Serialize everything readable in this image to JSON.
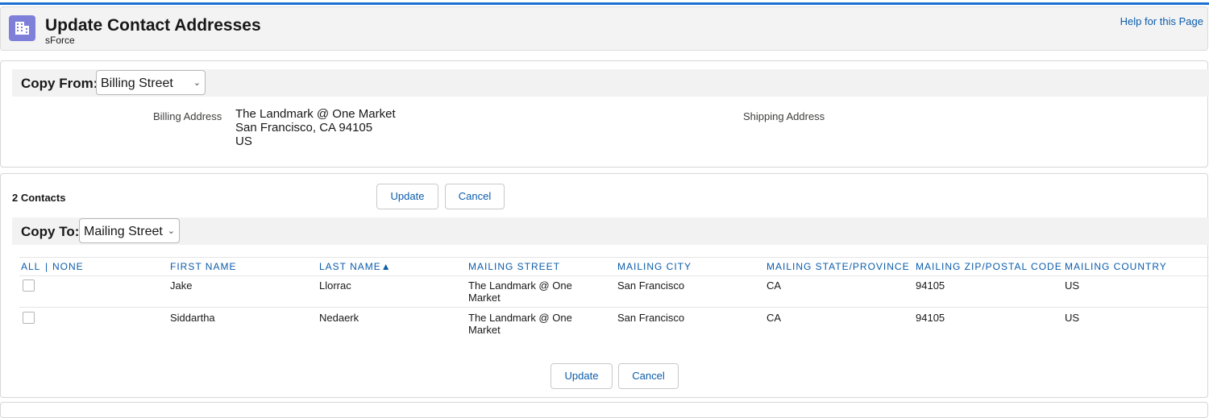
{
  "header": {
    "title": "Update Contact Addresses",
    "subtitle": "sForce",
    "help": "Help for this Page",
    "icon": "building-icon",
    "icon_color": "#7d7fd9"
  },
  "copy_from": {
    "label": "Copy From:",
    "selected": "Billing Street",
    "billing_label": "Billing Address",
    "billing_lines": [
      "The Landmark @ One Market",
      "San Francisco, CA 94105",
      "US"
    ],
    "shipping_label": "Shipping Address"
  },
  "contacts": {
    "count_label": "2 Contacts",
    "update": "Update",
    "cancel": "Cancel",
    "copy_to_label": "Copy To:",
    "copy_to_selected": "Mailing Street",
    "all": "ALL",
    "sep": "|",
    "none": "NONE",
    "columns": [
      "FIRST NAME",
      "LAST NAME▲",
      "MAILING STREET",
      "MAILING CITY",
      "MAILING STATE/PROVINCE",
      "MAILING ZIP/POSTAL CODE",
      "MAILING COUNTRY"
    ],
    "rows": [
      {
        "first": "Jake",
        "last": "Llorrac",
        "street": "The Landmark @ One Market",
        "city": "San Francisco",
        "state": "CA",
        "zip": "94105",
        "country": "US"
      },
      {
        "first": "Siddartha",
        "last": "Nedaerk",
        "street": "The Landmark @ One Market",
        "city": "San Francisco",
        "state": "CA",
        "zip": "94105",
        "country": "US"
      }
    ]
  },
  "colors": {
    "link": "#0b5cab",
    "accent": "#1b6fd1"
  }
}
